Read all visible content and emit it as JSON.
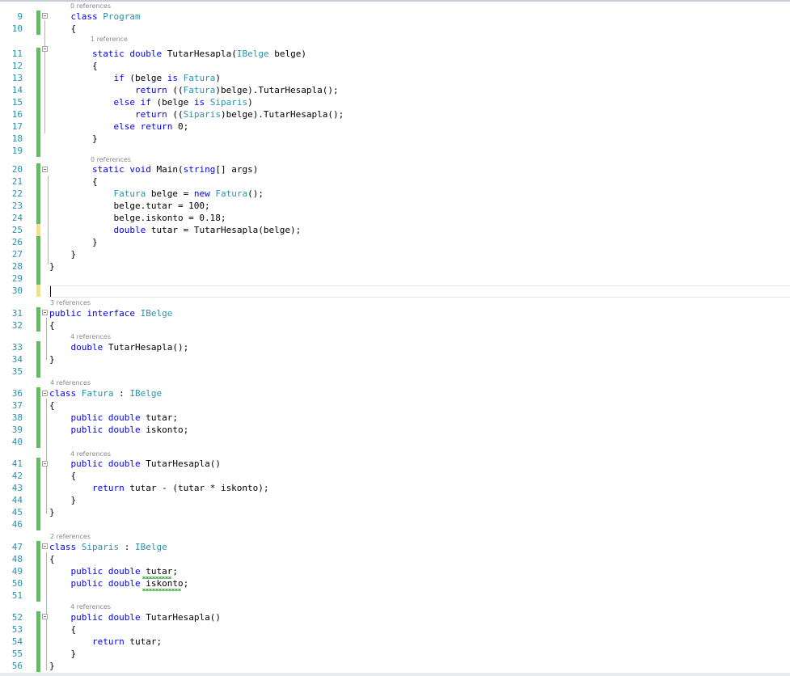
{
  "lens": {
    "program": "0 references",
    "tutarhesapla_static": "1 reference",
    "main": "0 references",
    "ibelge": "3 references",
    "ibelge_method": "4 references",
    "fatura": "4 references",
    "fatura_method": "4 references",
    "siparis": "2 references",
    "siparis_method": "4 references"
  },
  "lines": [
    {
      "n": "9",
      "tokens": [
        [
          "    ",
          ""
        ],
        [
          "class",
          "kw"
        ],
        [
          " ",
          ""
        ],
        [
          "Program",
          "ty"
        ]
      ]
    },
    {
      "n": "10",
      "tokens": [
        [
          "    {",
          ""
        ]
      ]
    },
    {
      "n": "11",
      "tokens": [
        [
          "        ",
          ""
        ],
        [
          "static",
          "kw"
        ],
        [
          " ",
          ""
        ],
        [
          "double",
          "kw"
        ],
        [
          " TutarHesapla(",
          ""
        ],
        [
          "IBelge",
          "ty"
        ],
        [
          " belge)",
          ""
        ]
      ]
    },
    {
      "n": "12",
      "tokens": [
        [
          "        {",
          ""
        ]
      ]
    },
    {
      "n": "13",
      "tokens": [
        [
          "            ",
          ""
        ],
        [
          "if",
          "kw"
        ],
        [
          " (belge ",
          ""
        ],
        [
          "is",
          "kw"
        ],
        [
          " ",
          ""
        ],
        [
          "Fatura",
          "ty"
        ],
        [
          ")",
          ""
        ]
      ]
    },
    {
      "n": "14",
      "tokens": [
        [
          "                ",
          ""
        ],
        [
          "return",
          "kw"
        ],
        [
          " ((",
          ""
        ],
        [
          "Fatura",
          "ty"
        ],
        [
          ")belge).TutarHesapla();",
          ""
        ]
      ]
    },
    {
      "n": "15",
      "tokens": [
        [
          "            ",
          ""
        ],
        [
          "else",
          "kw"
        ],
        [
          " ",
          ""
        ],
        [
          "if",
          "kw"
        ],
        [
          " (belge ",
          ""
        ],
        [
          "is",
          "kw"
        ],
        [
          " ",
          ""
        ],
        [
          "Siparis",
          "ty"
        ],
        [
          ")",
          ""
        ]
      ]
    },
    {
      "n": "16",
      "tokens": [
        [
          "                ",
          ""
        ],
        [
          "return",
          "kw"
        ],
        [
          " ((",
          ""
        ],
        [
          "Siparis",
          "ty"
        ],
        [
          ")belge).TutarHesapla();",
          ""
        ]
      ]
    },
    {
      "n": "17",
      "tokens": [
        [
          "            ",
          ""
        ],
        [
          "else",
          "kw"
        ],
        [
          " ",
          ""
        ],
        [
          "return",
          "kw"
        ],
        [
          " 0;",
          ""
        ]
      ]
    },
    {
      "n": "18",
      "tokens": [
        [
          "        }",
          ""
        ]
      ]
    },
    {
      "n": "19",
      "tokens": []
    },
    {
      "n": "20",
      "tokens": [
        [
          "        ",
          ""
        ],
        [
          "static",
          "kw"
        ],
        [
          " ",
          ""
        ],
        [
          "void",
          "kw"
        ],
        [
          " Main(",
          ""
        ],
        [
          "string",
          "kw"
        ],
        [
          "[] args)",
          ""
        ]
      ]
    },
    {
      "n": "21",
      "tokens": [
        [
          "        {",
          ""
        ]
      ]
    },
    {
      "n": "22",
      "tokens": [
        [
          "            ",
          ""
        ],
        [
          "Fatura",
          "ty"
        ],
        [
          " belge = ",
          ""
        ],
        [
          "new",
          "kw"
        ],
        [
          " ",
          ""
        ],
        [
          "Fatura",
          "ty"
        ],
        [
          "();",
          ""
        ]
      ]
    },
    {
      "n": "23",
      "tokens": [
        [
          "            belge.tutar = 100;",
          ""
        ]
      ]
    },
    {
      "n": "24",
      "tokens": [
        [
          "            belge.iskonto = 0.18;",
          ""
        ]
      ]
    },
    {
      "n": "25",
      "tokens": [
        [
          "            ",
          ""
        ],
        [
          "double",
          "kw"
        ],
        [
          " tutar = TutarHesapla(belge);",
          ""
        ]
      ]
    },
    {
      "n": "26",
      "tokens": [
        [
          "        }",
          ""
        ]
      ]
    },
    {
      "n": "27",
      "tokens": [
        [
          "    }",
          ""
        ]
      ]
    },
    {
      "n": "28",
      "tokens": [
        [
          "}",
          ""
        ]
      ]
    },
    {
      "n": "29",
      "tokens": []
    },
    {
      "n": "30",
      "tokens": []
    },
    {
      "n": "31",
      "tokens": [
        [
          "public",
          "kw"
        ],
        [
          " ",
          ""
        ],
        [
          "interface",
          "kw"
        ],
        [
          " ",
          ""
        ],
        [
          "IBelge",
          "ty"
        ]
      ]
    },
    {
      "n": "32",
      "tokens": [
        [
          "{",
          ""
        ]
      ]
    },
    {
      "n": "33",
      "tokens": [
        [
          "    ",
          ""
        ],
        [
          "double",
          "kw"
        ],
        [
          " TutarHesapla();",
          ""
        ]
      ]
    },
    {
      "n": "34",
      "tokens": [
        [
          "}",
          ""
        ]
      ]
    },
    {
      "n": "35",
      "tokens": []
    },
    {
      "n": "36",
      "tokens": [
        [
          "class",
          "kw"
        ],
        [
          " ",
          ""
        ],
        [
          "Fatura",
          "ty"
        ],
        [
          " : ",
          ""
        ],
        [
          "IBelge",
          "ty"
        ]
      ]
    },
    {
      "n": "37",
      "tokens": [
        [
          "{",
          ""
        ]
      ]
    },
    {
      "n": "38",
      "tokens": [
        [
          "    ",
          ""
        ],
        [
          "public",
          "kw"
        ],
        [
          " ",
          ""
        ],
        [
          "double",
          "kw"
        ],
        [
          " tutar;",
          ""
        ]
      ]
    },
    {
      "n": "39",
      "tokens": [
        [
          "    ",
          ""
        ],
        [
          "public",
          "kw"
        ],
        [
          " ",
          ""
        ],
        [
          "double",
          "kw"
        ],
        [
          " iskonto;",
          ""
        ]
      ]
    },
    {
      "n": "40",
      "tokens": []
    },
    {
      "n": "41",
      "tokens": [
        [
          "    ",
          ""
        ],
        [
          "public",
          "kw"
        ],
        [
          " ",
          ""
        ],
        [
          "double",
          "kw"
        ],
        [
          " TutarHesapla()",
          ""
        ]
      ]
    },
    {
      "n": "42",
      "tokens": [
        [
          "    {",
          ""
        ]
      ]
    },
    {
      "n": "43",
      "tokens": [
        [
          "        ",
          ""
        ],
        [
          "return",
          "kw"
        ],
        [
          " tutar - (tutar * iskonto);",
          ""
        ]
      ]
    },
    {
      "n": "44",
      "tokens": [
        [
          "    }",
          ""
        ]
      ]
    },
    {
      "n": "45",
      "tokens": [
        [
          "}",
          ""
        ]
      ]
    },
    {
      "n": "46",
      "tokens": []
    },
    {
      "n": "47",
      "tokens": [
        [
          "class",
          "kw"
        ],
        [
          " ",
          ""
        ],
        [
          "Siparis",
          "ty"
        ],
        [
          " : ",
          ""
        ],
        [
          "IBelge",
          "ty"
        ]
      ]
    },
    {
      "n": "48",
      "tokens": [
        [
          "{",
          ""
        ]
      ]
    },
    {
      "n": "49",
      "tokens": [
        [
          "    ",
          ""
        ],
        [
          "public",
          "kw"
        ],
        [
          " ",
          ""
        ],
        [
          "double",
          "kw"
        ],
        [
          " tutar;",
          ""
        ]
      ]
    },
    {
      "n": "50",
      "tokens": [
        [
          "    ",
          ""
        ],
        [
          "public",
          "kw"
        ],
        [
          " ",
          ""
        ],
        [
          "double",
          "kw"
        ],
        [
          " iskonto;",
          ""
        ]
      ]
    },
    {
      "n": "51",
      "tokens": []
    },
    {
      "n": "52",
      "tokens": [
        [
          "    ",
          ""
        ],
        [
          "public",
          "kw"
        ],
        [
          " ",
          ""
        ],
        [
          "double",
          "kw"
        ],
        [
          " TutarHesapla()",
          ""
        ]
      ]
    },
    {
      "n": "53",
      "tokens": [
        [
          "    {",
          ""
        ]
      ]
    },
    {
      "n": "54",
      "tokens": [
        [
          "        ",
          ""
        ],
        [
          "return",
          "kw"
        ],
        [
          " tutar;",
          ""
        ]
      ]
    },
    {
      "n": "55",
      "tokens": [
        [
          "    }",
          ""
        ]
      ]
    },
    {
      "n": "56",
      "tokens": [
        [
          "}",
          ""
        ]
      ]
    }
  ]
}
